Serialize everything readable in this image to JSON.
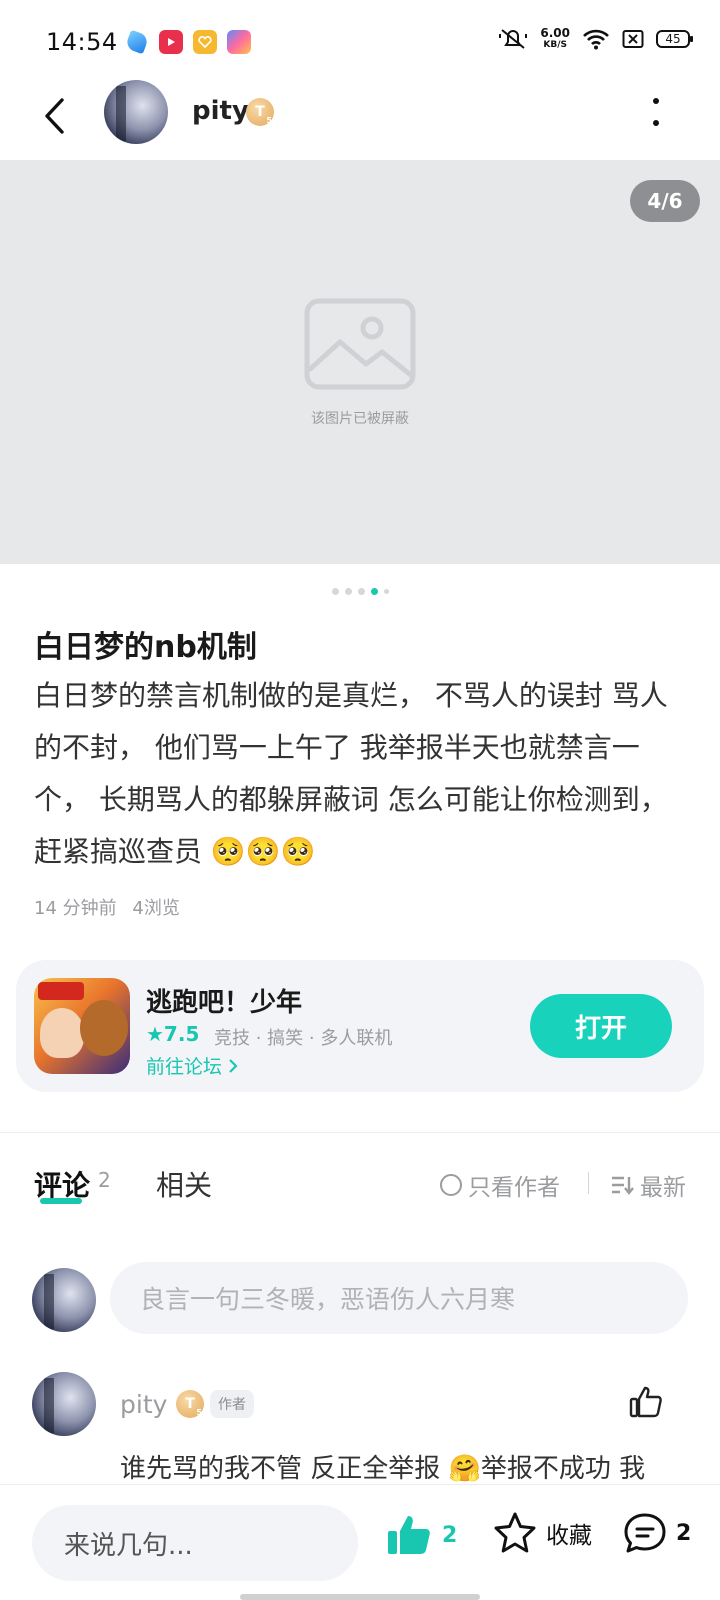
{
  "status_bar": {
    "time": "14:54",
    "net_speed_value": "6.00",
    "net_speed_unit": "KB/S",
    "battery": "45"
  },
  "header": {
    "author_name": "pity",
    "level": "T",
    "level_sub": "5"
  },
  "image": {
    "counter": "4/6",
    "blocked_text": "该图片已被屏蔽"
  },
  "post": {
    "title": "白日梦的nb机制",
    "body": "白日梦的禁言机制做的是真烂， 不骂人的误封 骂人的不封， 他们骂一上午了 我举报半天也就禁言一个， 长期骂人的都躲屏蔽词 怎么可能让你检测到， 赶紧搞巡查员 🥺🥺🥺",
    "time_ago": "14 分钟前",
    "views": "4浏览"
  },
  "game_card": {
    "name": "逃跑吧！少年",
    "rating": "★7.5",
    "tags": "竞技 · 搞笑 · 多人联机",
    "forum_link": "前往论坛",
    "open_button": "打开",
    "icon_text": "熊出没"
  },
  "tabs": {
    "comments_label": "评论",
    "comments_count": "2",
    "related_label": "相关",
    "only_author": "只看作者",
    "sort": "最新"
  },
  "comment_input": {
    "placeholder": "良言一句三冬暖，恶语伤人六月寒"
  },
  "comments": [
    {
      "name": "pity",
      "level": "T",
      "level_sub": "5",
      "tag": "作者",
      "text": "谁先骂的我不管 反正全举报 🤗举报不成功 我"
    }
  ],
  "bottom_bar": {
    "input_placeholder": "来说几句...",
    "like_count": "2",
    "favorite_label": "收藏",
    "comment_count": "2"
  },
  "colors": {
    "accent": "#19c7b1",
    "badge": "#e3a95d",
    "image_bg": "#e7e8ea"
  }
}
